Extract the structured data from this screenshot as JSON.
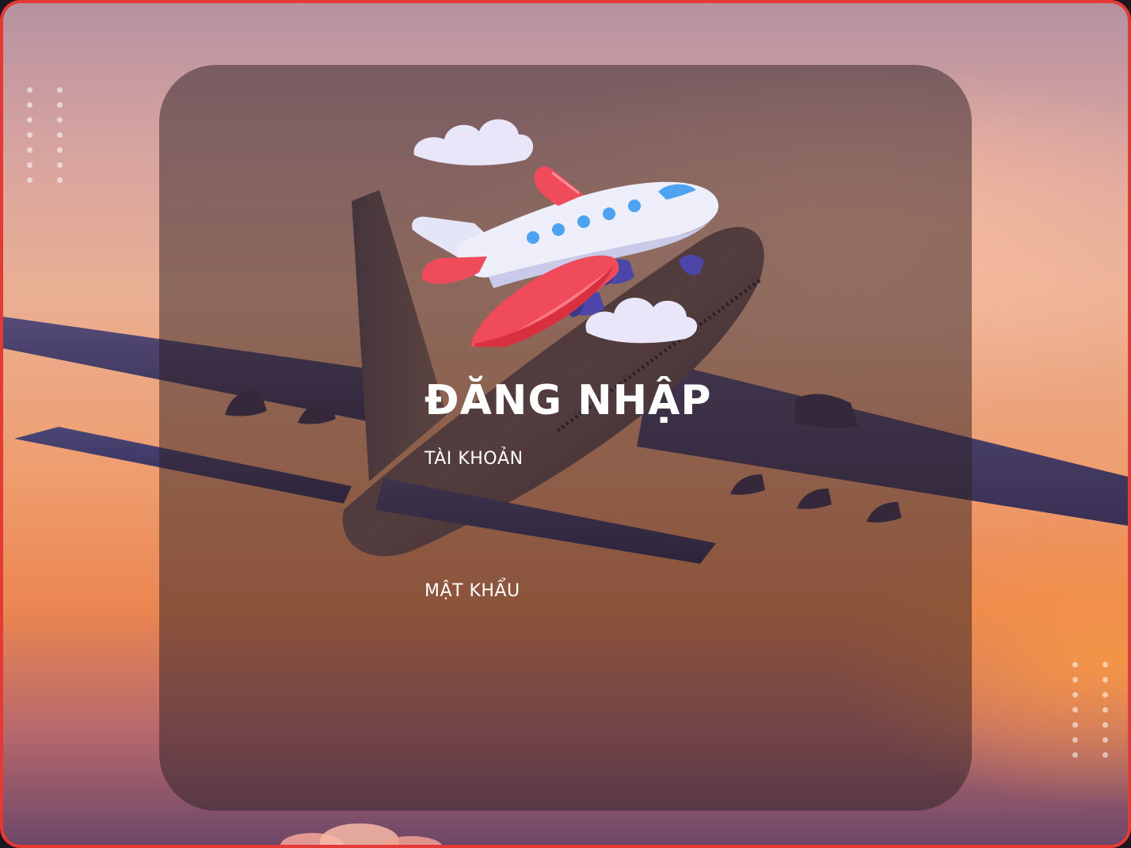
{
  "login": {
    "title": "ĐĂNG NHẬP",
    "username_label": "TÀI KHOẢN",
    "password_label": "MẬT KHẨU",
    "username_value": "",
    "password_value": ""
  },
  "icons": {
    "logo": "airplane-clouds-icon",
    "background": "airliner-sunset-photo"
  },
  "colors": {
    "border": "#e53935",
    "panel": "rgba(46,32,36,0.5)",
    "plane_red": "#ef4b5a",
    "plane_blue": "#4ea3f1",
    "cloud": "#eae9f8",
    "text": "#ffffff"
  }
}
